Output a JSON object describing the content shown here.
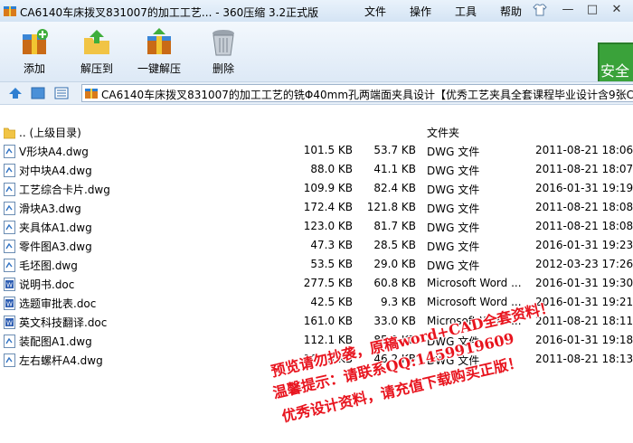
{
  "window": {
    "title": "CA6140车床拨叉831007的加工工艺...  - 360压缩 3.2正式版",
    "menu": [
      "文件",
      "操作",
      "工具",
      "帮助"
    ],
    "controls": [
      "—",
      "□",
      "✕"
    ]
  },
  "toolbar": {
    "buttons": [
      {
        "label": "添加",
        "icon": "add-archive-icon"
      },
      {
        "label": "解压到",
        "icon": "extract-to-icon"
      },
      {
        "label": "一键解压",
        "icon": "one-click-extract-icon"
      },
      {
        "label": "删除",
        "icon": "delete-trash-icon"
      }
    ],
    "security_badge": "安全"
  },
  "address": {
    "path": "CA6140车床拨叉831007的加工工艺的铣Φ40mm孔两端面夹具设计【优秀工艺夹具全套课程毕业设计含9张C"
  },
  "files": [
    {
      "name": ".. (上级目录)",
      "size": "",
      "packed": "",
      "type": "文件夹",
      "date": "",
      "icon": "folder-icon"
    },
    {
      "name": "V形块A4.dwg",
      "size": "101.5 KB",
      "packed": "53.7 KB",
      "type": "DWG 文件",
      "date": "2011-08-21 18:06",
      "icon": "dwg-file-icon"
    },
    {
      "name": "对中块A4.dwg",
      "size": "88.0 KB",
      "packed": "41.1 KB",
      "type": "DWG 文件",
      "date": "2011-08-21 18:07",
      "icon": "dwg-file-icon"
    },
    {
      "name": "工艺综合卡片.dwg",
      "size": "109.9 KB",
      "packed": "82.4 KB",
      "type": "DWG 文件",
      "date": "2016-01-31 19:19",
      "icon": "dwg-file-icon"
    },
    {
      "name": "滑块A3.dwg",
      "size": "172.4 KB",
      "packed": "121.8 KB",
      "type": "DWG 文件",
      "date": "2011-08-21 18:08",
      "icon": "dwg-file-icon"
    },
    {
      "name": "夹具体A1.dwg",
      "size": "123.0 KB",
      "packed": "81.7 KB",
      "type": "DWG 文件",
      "date": "2011-08-21 18:08",
      "icon": "dwg-file-icon"
    },
    {
      "name": "零件图A3.dwg",
      "size": "47.3 KB",
      "packed": "28.5 KB",
      "type": "DWG 文件",
      "date": "2016-01-31 19:23",
      "icon": "dwg-file-icon"
    },
    {
      "name": "毛坯图.dwg",
      "size": "53.5 KB",
      "packed": "29.0 KB",
      "type": "DWG 文件",
      "date": "2012-03-23 17:26",
      "icon": "dwg-file-icon"
    },
    {
      "name": "说明书.doc",
      "size": "277.5 KB",
      "packed": "60.8 KB",
      "type": "Microsoft Word ...",
      "date": "2016-01-31 19:30",
      "icon": "doc-file-icon"
    },
    {
      "name": "选题审批表.doc",
      "size": "42.5 KB",
      "packed": "9.3 KB",
      "type": "Microsoft Word ...",
      "date": "2016-01-31 19:21",
      "icon": "doc-file-icon"
    },
    {
      "name": "英文科技翻译.doc",
      "size": "161.0 KB",
      "packed": "33.0 KB",
      "type": "Microsoft Word ...",
      "date": "2011-08-21 18:11",
      "icon": "doc-file-icon"
    },
    {
      "name": "装配图A1.dwg",
      "size": "112.1 KB",
      "packed": "85.0 KB",
      "type": "DWG 文件",
      "date": "2016-01-31 19:18",
      "icon": "dwg-file-icon"
    },
    {
      "name": "左右螺杆A4.dwg",
      "size": "100.5 KB",
      "packed": "46.2 KB",
      "type": "DWG 文件",
      "date": "2011-08-21 18:13",
      "icon": "dwg-file-icon"
    }
  ],
  "watermark": {
    "lines": [
      "预览请勿抄袭，原稿word+CAD全套资料！",
      "温馨提示：请联系QQ:1459919609",
      "优秀设计资料，请充值下载购买正版！"
    ],
    "color": "#e8141e"
  }
}
